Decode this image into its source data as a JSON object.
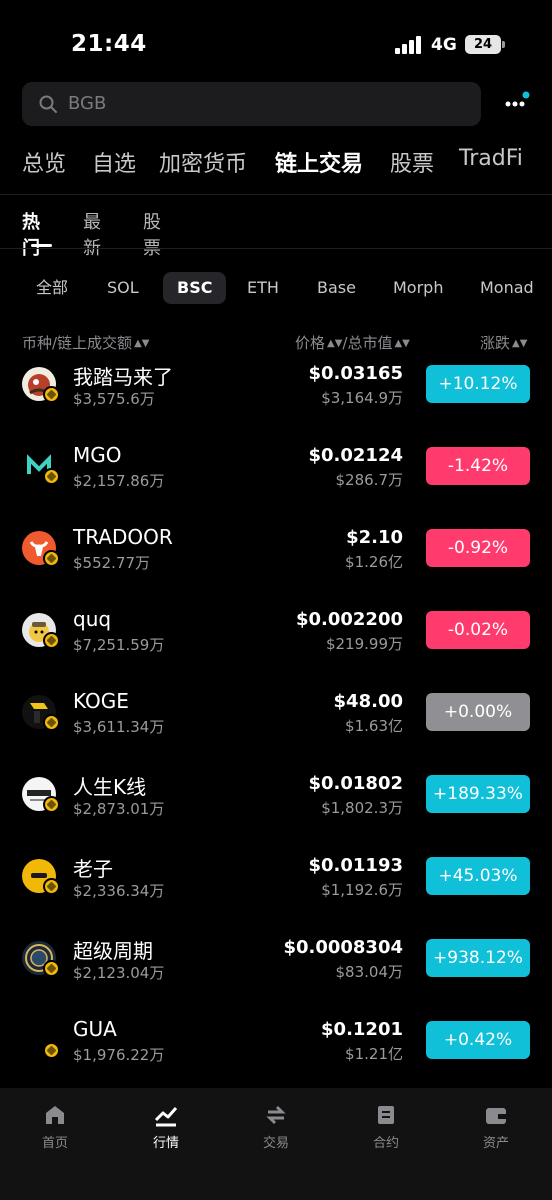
{
  "status_bar": {
    "time": "21:44",
    "network": "4G",
    "battery": "24"
  },
  "search": {
    "placeholder": "BGB"
  },
  "main_tabs": [
    "总览",
    "自选",
    "加密货币",
    "链上交易",
    "股票",
    "TradFi"
  ],
  "sub_tabs": [
    "热门",
    "最新",
    "股票"
  ],
  "chain_filters": [
    "全部",
    "SOL",
    "BSC",
    "ETH",
    "Base",
    "Morph",
    "Monad"
  ],
  "columns": {
    "pair": "币种/链上成交额",
    "price": "价格",
    "sep": "/",
    "mcap": "总市值",
    "change": "涨跌"
  },
  "tokens": [
    {
      "name": "我踏马来了",
      "volume": "$3,575.6万",
      "price": "$0.03165",
      "mcap": "$3,164.9万",
      "change": "+10.12%",
      "dir": "up"
    },
    {
      "name": "MGO",
      "volume": "$2,157.86万",
      "price": "$0.02124",
      "mcap": "$286.7万",
      "change": "-1.42%",
      "dir": "down"
    },
    {
      "name": "TRADOOR",
      "volume": "$552.77万",
      "price": "$2.10",
      "mcap": "$1.26亿",
      "change": "-0.92%",
      "dir": "down"
    },
    {
      "name": "quq",
      "volume": "$7,251.59万",
      "price": "$0.002200",
      "mcap": "$219.99万",
      "change": "-0.02%",
      "dir": "down"
    },
    {
      "name": "KOGE",
      "volume": "$3,611.34万",
      "price": "$48.00",
      "mcap": "$1.63亿",
      "change": "+0.00%",
      "dir": "flat"
    },
    {
      "name": "人生K线",
      "volume": "$2,873.01万",
      "price": "$0.01802",
      "mcap": "$1,802.3万",
      "change": "+189.33%",
      "dir": "up"
    },
    {
      "name": "老子",
      "volume": "$2,336.34万",
      "price": "$0.01193",
      "mcap": "$1,192.6万",
      "change": "+45.03%",
      "dir": "up"
    },
    {
      "name": "超级周期",
      "volume": "$2,123.04万",
      "price": "$0.0008304",
      "mcap": "$83.04万",
      "change": "+938.12%",
      "dir": "up"
    },
    {
      "name": "GUA",
      "volume": "$1,976.22万",
      "price": "$0.1201",
      "mcap": "$1.21亿",
      "change": "+0.42%",
      "dir": "up"
    }
  ],
  "bottom_nav": [
    "首页",
    "行情",
    "交易",
    "合约",
    "资产"
  ],
  "colors": {
    "up": "#10c0d8",
    "down": "#ff3b6e",
    "flat": "#8f8f94",
    "bsc_badge": "#f0b90b"
  }
}
